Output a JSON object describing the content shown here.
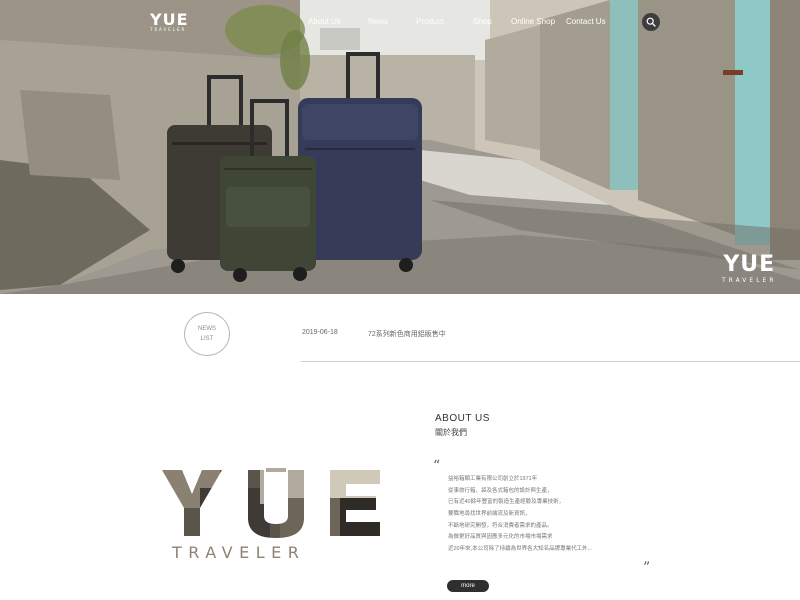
{
  "nav": {
    "logo": "YUE",
    "logo_sub": "TRAVELER",
    "items": [
      {
        "label": "About Us"
      },
      {
        "label": "News"
      },
      {
        "label": "Product"
      },
      {
        "label": "Shop"
      },
      {
        "label": "Online Shop"
      },
      {
        "label": "Contact Us"
      }
    ],
    "search_icon": "search-icon"
  },
  "hero": {
    "brand": "YUE",
    "brand_sub": "TRAVELER"
  },
  "news": {
    "circle_line1": "NEWS",
    "circle_line2": "LIST",
    "date": "2019-06-18",
    "title": "72系列新色商用鋁販售中"
  },
  "about": {
    "brand": "YUE",
    "brand_sub": "TRAVELER",
    "title": "ABOUT US",
    "subtitle": "關於我們",
    "quote_open": "“",
    "quote_close": "”",
    "lines": [
      "益裕箱類工業有限公司創立於1971年",
      "從事旅行箱、袋及各式箱包的設計與生產，",
      "已有近40餘年豐富的製造生產經驗及專業技術，",
      "要職地尋找世界前端流及新資訊，",
      "不斷地研究開發，符合消費者需求的產品。",
      "為做更好品質與因應多元化的市場市場需求",
      "近20年來,本公司除了持續為世界各大知名品牌專業代工外..."
    ],
    "more_label": "more"
  },
  "colors": {
    "nav_text": "#ffffff",
    "search_bg": "#3d3d3d",
    "more_bg": "#2f2f2f",
    "brand_sub": "#8d8273"
  }
}
